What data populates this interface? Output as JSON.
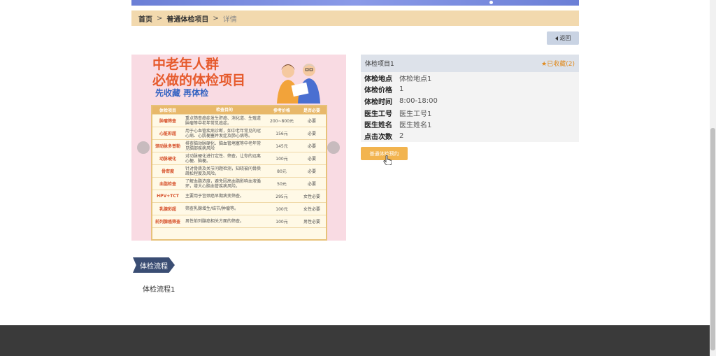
{
  "breadcrumb": {
    "home": "首页",
    "sep1": ">",
    "category": "普通体检项目",
    "sep2": ">",
    "current": "详情"
  },
  "back_button": {
    "label": "返回"
  },
  "poster": {
    "title_line1": "中老年人群",
    "title_line2": "必做的体检项目",
    "subtitle": "先收藏 再体检",
    "table_head": [
      "体检项目",
      "检查目的",
      "参考价格",
      "是否必要"
    ],
    "table_rows": [
      [
        "肿瘤筛查",
        "重点筛查癌症发生肝癌、消化道、生殖道肿瘤等中老年常见癌症。",
        "200~800元",
        "必要"
      ],
      [
        "心脏彩超",
        "用于心血管疾病诊断，如中老年常见的冠心病、心肌梗塞并发症及肺心病等。",
        "156元",
        "必要"
      ],
      [
        "颈动脉多普勒",
        "排查脑动脉硬化、脑血管堵塞等中老年常见脑部疾病风险",
        "145元",
        "必要"
      ],
      [
        "动脉硬化",
        "对动脉硬化进行定性、筛查，让你的远离心梗、脑梗。",
        "100元",
        "必要"
      ],
      [
        "骨密度",
        "针对骨质及关节问题检测，知晓被问骨质疏松程度及风险。",
        "80元",
        "必要"
      ],
      [
        "血脂检查",
        "了解血脂浓度，避免因高血脂影响血液循环，增大心脑血管疾病风险。",
        "50元",
        "必要"
      ],
      [
        "HPV+TCT",
        "主要用于宫颈癌早期病变筛查。",
        "295元",
        "女性必要"
      ],
      [
        "乳腺彩超",
        "筛查乳腺增生/结节/肿瘤等。",
        "100元",
        "女性必要"
      ],
      [
        "前列腺癌筛查",
        "男性前列腺癌相关方面的筛查。",
        "100元",
        "男性必要"
      ]
    ]
  },
  "info": {
    "title": "体检项目1",
    "favorite": "★已收藏(2)",
    "rows": [
      {
        "label": "体检地点",
        "value": "体检地点1"
      },
      {
        "label": "体检价格",
        "value": "1"
      },
      {
        "label": "体检时间",
        "value": "8:00-18:00"
      },
      {
        "label": "医生工号",
        "value": "医生工号1"
      },
      {
        "label": "医生姓名",
        "value": "医生姓名1"
      },
      {
        "label": "点击次数",
        "value": "2"
      }
    ]
  },
  "book_button": {
    "label": "普通体检预约"
  },
  "flow": {
    "tag": "体检流程",
    "text": "体检流程1"
  },
  "colors": {
    "accent": "#f2b44f",
    "breadcrumb_bg": "#f2d9ae",
    "footer": "#3a3a3a",
    "favorite": "#e08a1e"
  }
}
